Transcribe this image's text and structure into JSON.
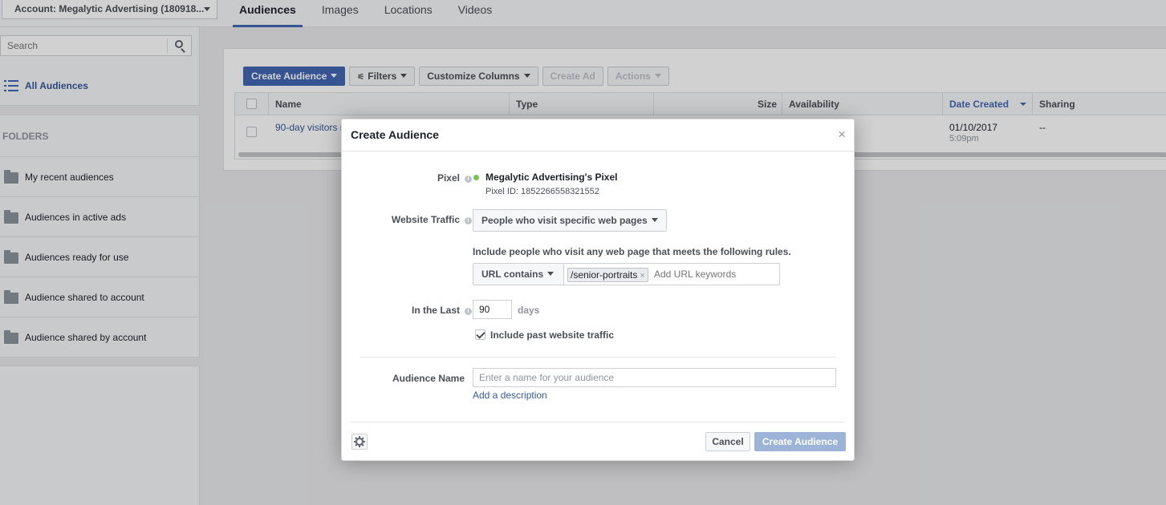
{
  "account": {
    "label": "Account: Megalytic Advertising (180918..."
  },
  "tabs": [
    {
      "label": "Audiences",
      "active": true
    },
    {
      "label": "Images"
    },
    {
      "label": "Locations"
    },
    {
      "label": "Videos"
    }
  ],
  "sidebar": {
    "search_placeholder": "Search",
    "all_audiences": "All Audiences",
    "folders_heading": "FOLDERS",
    "folders": [
      "My recent audiences",
      "Audiences in active ads",
      "Audiences ready for use",
      "Audience shared to account",
      "Audience shared by account"
    ]
  },
  "toolbar": {
    "create_audience": "Create Audience",
    "filters": "Filters",
    "customize_columns": "Customize Columns",
    "create_ad": "Create Ad",
    "actions": "Actions"
  },
  "table": {
    "columns": [
      "Name",
      "Type",
      "Size",
      "Availability",
      "Date Created",
      "Sharing"
    ],
    "rows": [
      {
        "name": "90-day visitors r",
        "date": "01/10/2017",
        "time": "5:09pm",
        "sharing": "--"
      }
    ]
  },
  "modal": {
    "title": "Create Audience",
    "close": "×",
    "pixel_label": "Pixel",
    "pixel_name": "Megalytic Advertising's Pixel",
    "pixel_id": "Pixel ID: 1852266558321552",
    "traffic_label": "Website Traffic",
    "traffic_value": "People who visit specific web pages",
    "rule_text": "Include people who visit any web page that meets the following rules.",
    "url_rule": "URL contains",
    "url_token": "/senior-portraits",
    "url_placeholder": "Add URL keywords",
    "in_last_label": "In the Last",
    "in_last_value": "90",
    "days_label": "days",
    "include_past": "Include past website traffic",
    "audience_name_label": "Audience Name",
    "audience_name_placeholder": "Enter a name for your audience",
    "add_description": "Add a description",
    "cancel": "Cancel",
    "create": "Create Audience"
  },
  "colors": {
    "brand_blue": "#4267b2",
    "link_blue": "#365899",
    "disabled_primary": "#9cb4d8",
    "pixel_active": "#7bc152"
  }
}
